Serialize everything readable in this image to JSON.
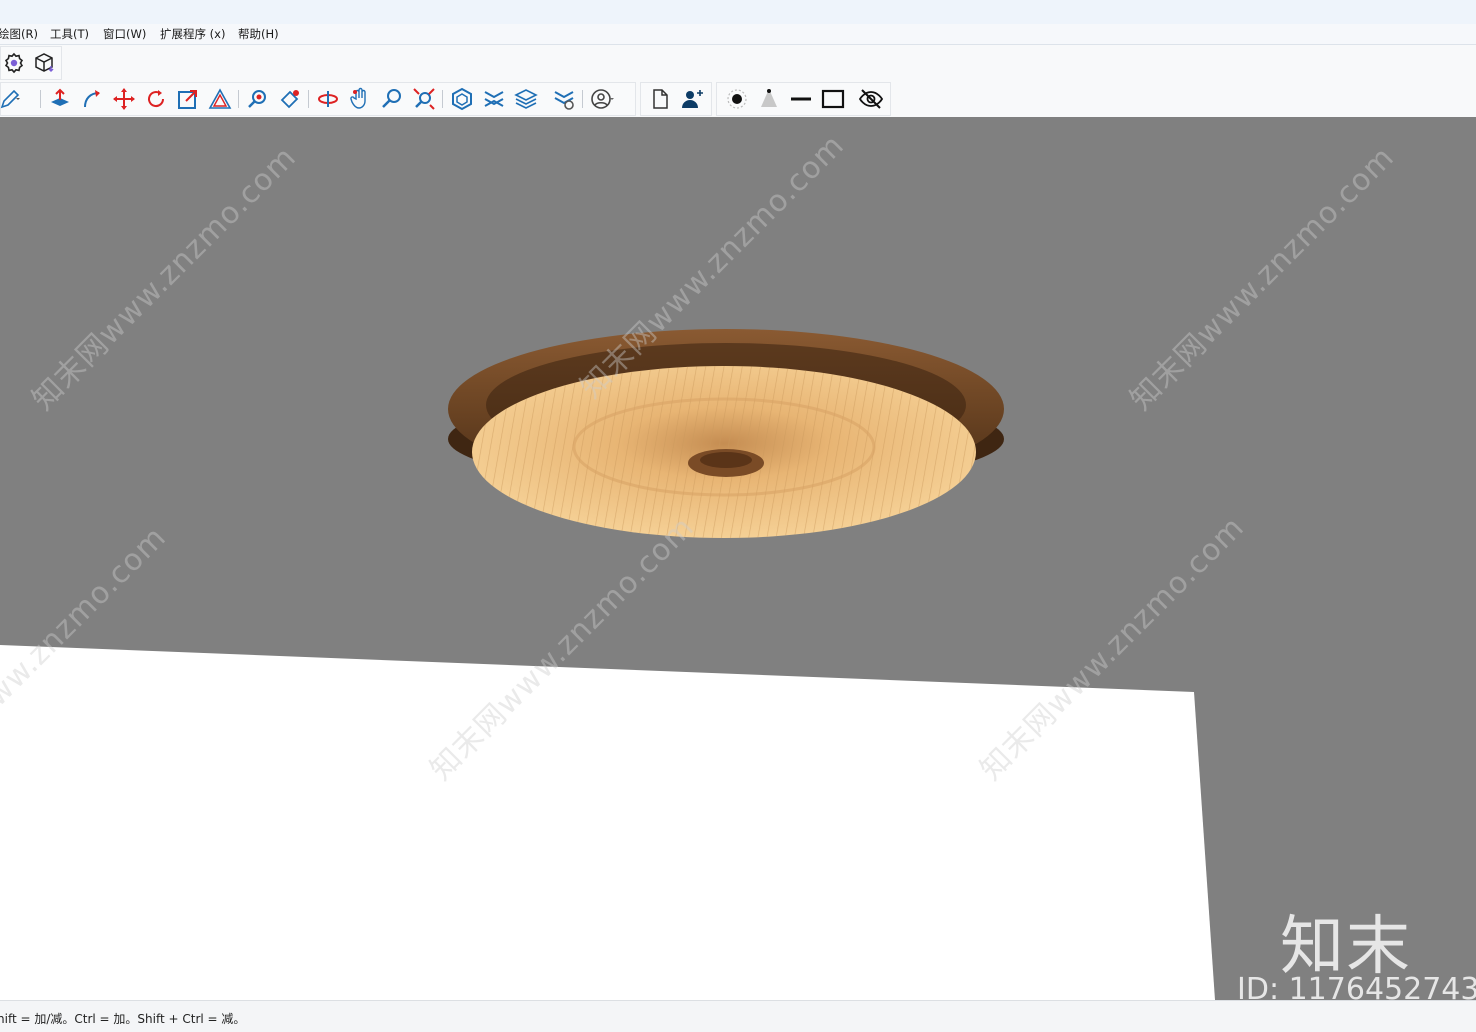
{
  "menu": {
    "items": [
      "绘图(R)",
      "工具(T)",
      "窗口(W)",
      "扩展程序 (x)",
      "帮助(H)"
    ]
  },
  "toolbar_row1": {
    "icons": [
      "settings-gear-icon",
      "component-box-icon"
    ]
  },
  "toolbar_row2": {
    "icons": [
      "pencil-dropdown-icon",
      "push-pull-icon",
      "follow-me-icon",
      "move-icon",
      "rotate-icon",
      "scale-icon",
      "offset-icon",
      "zoom-window-icon",
      "paint-bucket-icon",
      "orbit-icon",
      "pan-icon",
      "zoom-icon",
      "zoom-extents-icon",
      "3d-warehouse-icon",
      "extension-warehouse-icon",
      "layers-icon",
      "layout-icon",
      "account-icon",
      "new-document-icon",
      "add-user-icon",
      "point-style-icon",
      "cone-icon",
      "line-style-icon",
      "rectangle-style-icon",
      "hide-icon"
    ]
  },
  "viewport": {
    "background_color": "#808080",
    "floor_color": "#ffffff",
    "model": "ceiling lamp with wooden rim and pleated shade",
    "rim_color": "#6b4423",
    "shade_color": "#f0c27a"
  },
  "watermark": {
    "text": "知末网www.znzmo.com",
    "logo_text": "知末",
    "id_text": "ID: 1176452743"
  },
  "statusbar": {
    "text": "hift = 加/减。Ctrl = 加。Shift + Ctrl = 减。"
  }
}
